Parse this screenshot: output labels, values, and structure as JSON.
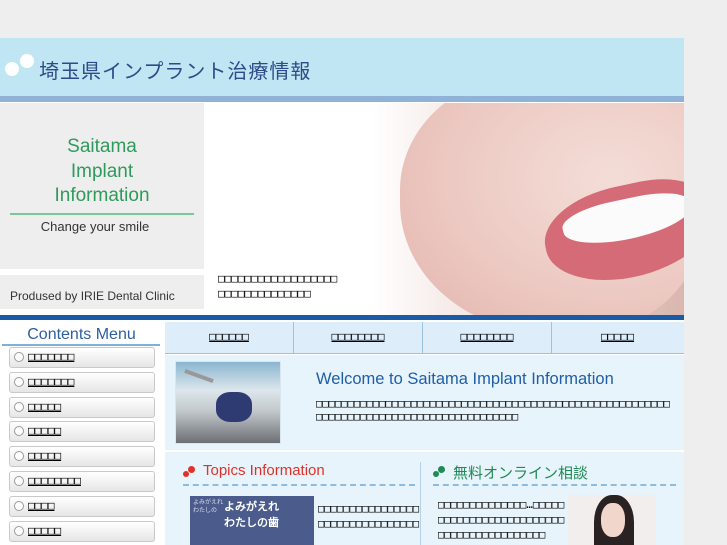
{
  "header": {
    "title": "埼玉県インプラント治療情報"
  },
  "hero": {
    "brand_lines": [
      "Saitama",
      "Implant",
      "Information"
    ],
    "tagline": "Change your smile",
    "produced_by": "Prodused by IRIE Dental Clinic",
    "caption_lines": [
      "□□□□□□□□□□□□□□□□□□",
      "□□□□□□□□□□□□□□"
    ]
  },
  "sidebar": {
    "title": "Contents Menu",
    "items": [
      {
        "label": "□□□□□□□"
      },
      {
        "label": "□□□□□□□"
      },
      {
        "label": "□□□□□"
      },
      {
        "label": "□□□□□"
      },
      {
        "label": "□□□□□"
      },
      {
        "label": "□□□□□□□□"
      },
      {
        "label": "□□□□"
      },
      {
        "label": "□□□□□"
      },
      {
        "label": "□□□□□"
      }
    ]
  },
  "nav": {
    "tabs": [
      {
        "label": "□□□□□□"
      },
      {
        "label": "□□□□□□□□"
      },
      {
        "label": "□□□□□□□□"
      },
      {
        "label": "□□□□□"
      }
    ]
  },
  "welcome": {
    "heading": "Welcome to Saitama Implant Information",
    "body": "□□□□□□□□□□□□□□□□□□□□□□□□□□□□□□□□□□□□□□□□□□□□□□□□□□□□□□□□□□□□□□□□□□□□□□□□□□□□□□□□□□□□□□□□"
  },
  "topics": {
    "title": "Topics Information",
    "image_text": [
      "よみがえれ",
      "わたしの歯"
    ],
    "text_lines": [
      "□□□□□□□□□□□□□□□□",
      "□□□□□□□□□□□□□□□□"
    ]
  },
  "consult": {
    "title": "無料オンライン相談",
    "text": "□□□□□□□□□□□□□□…□□□□□□□□□□□□□□□□□□□□□□□□□□□□□□□□□□□□□□□□□□"
  },
  "colors": {
    "header_bg": "#bfe6f2",
    "brand_green": "#2f9a5c",
    "accent_blue": "#1b5aa6",
    "topics_red": "#e0322a",
    "consult_green": "#1e8a54"
  }
}
